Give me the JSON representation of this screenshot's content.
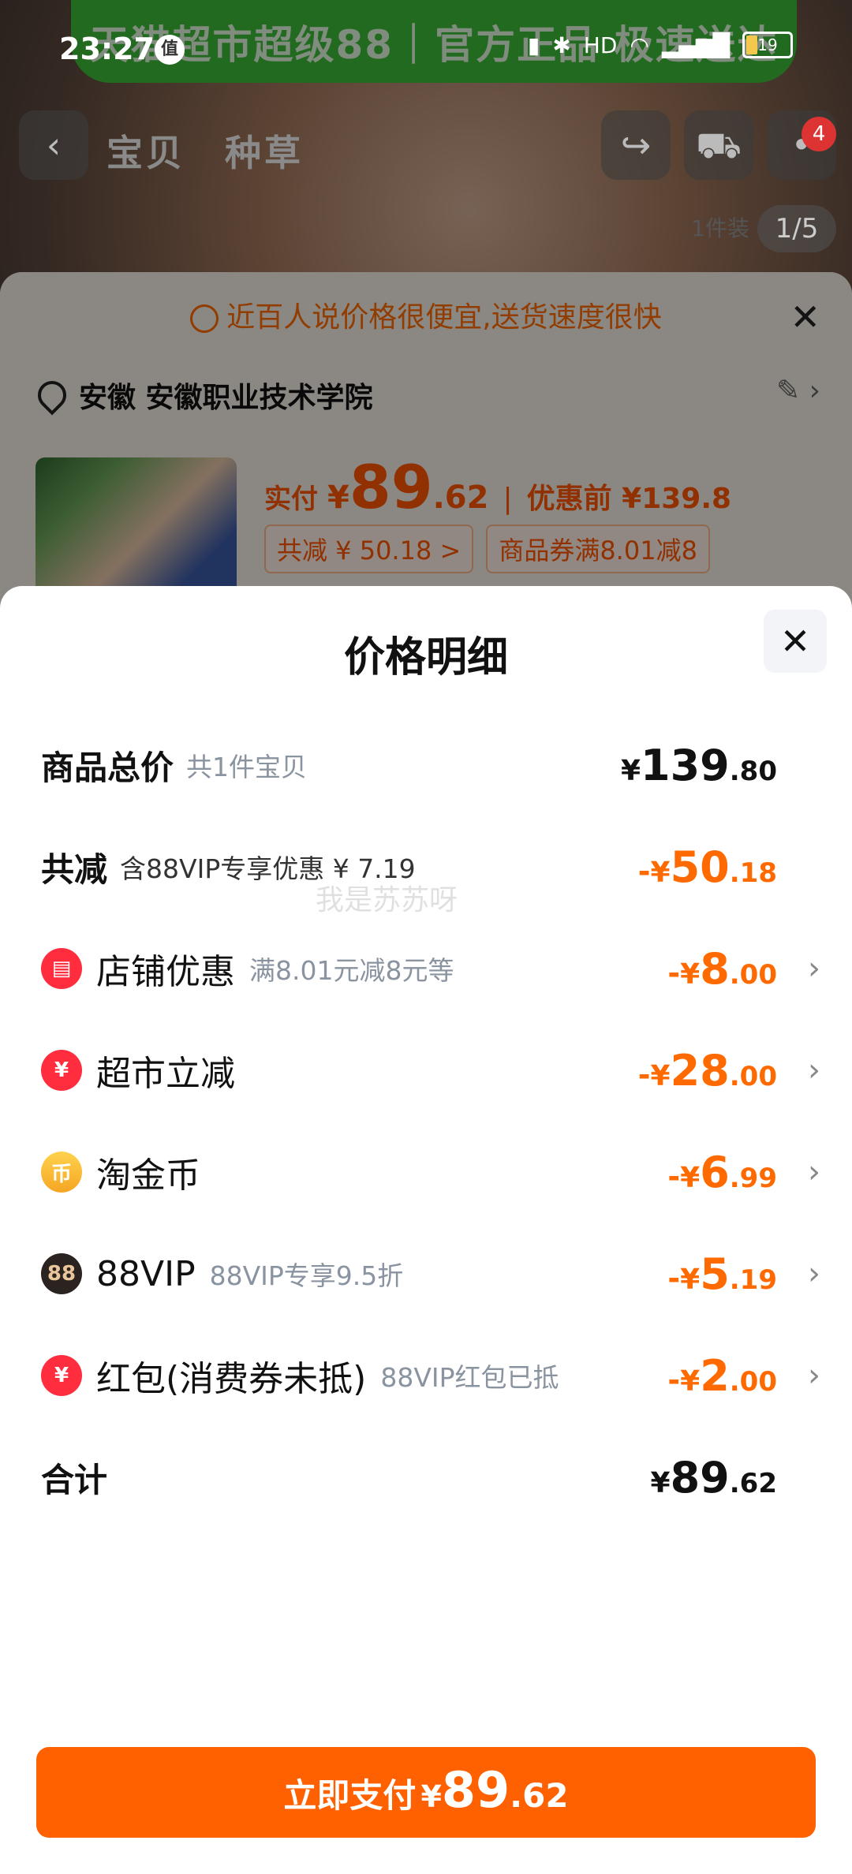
{
  "status_bar": {
    "time": "23:27",
    "notif_badge": "值",
    "battery": "19"
  },
  "background": {
    "banner": "天猫超市超级88｜官方正品 极速送达",
    "nav_tabs": [
      "宝贝",
      "种草"
    ],
    "cart_badge": "4",
    "image_tag": "1件装",
    "image_pager": "1/5"
  },
  "order_sheet": {
    "hint": "近百人说价格很便宜,送货速度很快",
    "address": "安徽 安徽职业技术学院",
    "pay_label": "实付",
    "pay_yen": "¥",
    "pay_int": "89",
    "pay_dec": ".62",
    "separator": "|",
    "orig_price": "优惠前 ¥139.8",
    "chip_discount": "共减 ¥ 50.18 >",
    "chip_coupon": "商品券满8.01减8"
  },
  "price_detail": {
    "title": "价格明细",
    "total": {
      "label": "商品总价",
      "note": "共1件宝贝",
      "yen": "¥",
      "int": "139",
      "dec": ".80"
    },
    "discount": {
      "label": "共减",
      "note": "含88VIP专享优惠 ¥ 7.19",
      "sign": "-",
      "yen": "¥",
      "int": "50",
      "dec": ".18"
    },
    "items": [
      {
        "icon": "store-icon",
        "label": "店铺优惠",
        "note": "满8.01元减8元等",
        "sign": "-",
        "yen": "¥",
        "int": "8",
        "dec": ".00"
      },
      {
        "icon": "supermarket-icon",
        "label": "超市立减",
        "note": "",
        "sign": "-",
        "yen": "¥",
        "int": "28",
        "dec": ".00"
      },
      {
        "icon": "gold-coin-icon",
        "label": "淘金币",
        "note": "",
        "sign": "-",
        "yen": "¥",
        "int": "6",
        "dec": ".99"
      },
      {
        "icon": "vip88-icon",
        "label": "88VIP",
        "note": "88VIP专享9.5折",
        "sign": "-",
        "yen": "¥",
        "int": "5",
        "dec": ".19"
      },
      {
        "icon": "red-packet-icon",
        "label": "红包(消费券未抵)",
        "note": "88VIP红包已抵",
        "sign": "-",
        "yen": "¥",
        "int": "2",
        "dec": ".00"
      }
    ],
    "sum": {
      "label": "合计",
      "yen": "¥",
      "int": "89",
      "dec": ".62"
    },
    "watermark": "我是苏苏呀"
  },
  "pay_button": {
    "label": "立即支付",
    "yen": "¥",
    "int": "89",
    "dec": ".62"
  },
  "colors": {
    "accent": "#ff6000",
    "discount": "#ff6a00"
  }
}
